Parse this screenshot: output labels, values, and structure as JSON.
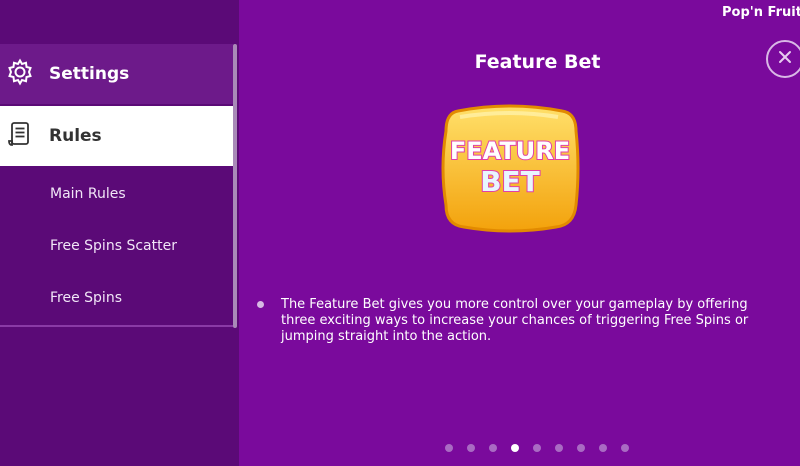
{
  "brand": "Pop'n Fruit",
  "sidebar": {
    "settings_label": "Settings",
    "rules_label": "Rules",
    "sub_items": [
      "Main Rules",
      "Free Spins Scatter",
      "Free Spins"
    ]
  },
  "main": {
    "title": "Feature Bet",
    "logo_line1": "FEATURE",
    "logo_line2": "BET",
    "body": "The Feature Bet gives you more control over your gameplay by offering three exciting ways to increase your chances of triggering Free Spins or jumping straight into the action."
  },
  "pagination": {
    "total": 9,
    "active_index": 3
  },
  "colors": {
    "background": "#7a0a9c",
    "sidebar": "#5b0a77",
    "accent": "#ffffff"
  }
}
